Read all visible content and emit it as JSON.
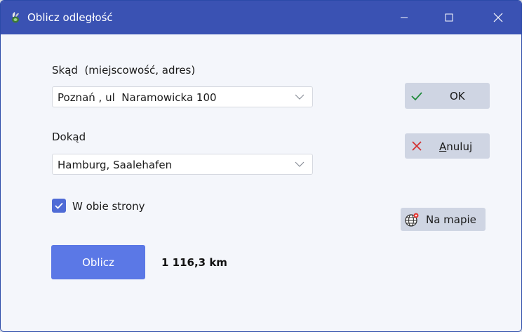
{
  "window": {
    "title": "Oblicz odległość",
    "controls": {
      "minimize": "minimize-icon",
      "maximize": "maximize-icon",
      "close": "close-icon"
    }
  },
  "form": {
    "from_label": "Skąd  (miejscowość, adres)",
    "from_value": "Poznań , ul  Naramowicka 100",
    "to_label": "Dokąd",
    "to_value": "Hamburg, Saalehafen",
    "both_ways_label": "W obie strony",
    "both_ways_checked": true
  },
  "buttons": {
    "ok_label": "OK",
    "cancel_label": "Anuluj",
    "cancel_accel": "A",
    "cancel_rest": "nuluj",
    "map_label": "Na mapie",
    "calculate_label": "Oblicz"
  },
  "result": {
    "distance": "1 116,3 km"
  },
  "colors": {
    "titlebar": "#3a52b3",
    "primary_button": "#5b78e6",
    "checkbox": "#4f6bd6",
    "ok_check": "#1f8a3a",
    "cancel_x": "#d32f2f"
  }
}
